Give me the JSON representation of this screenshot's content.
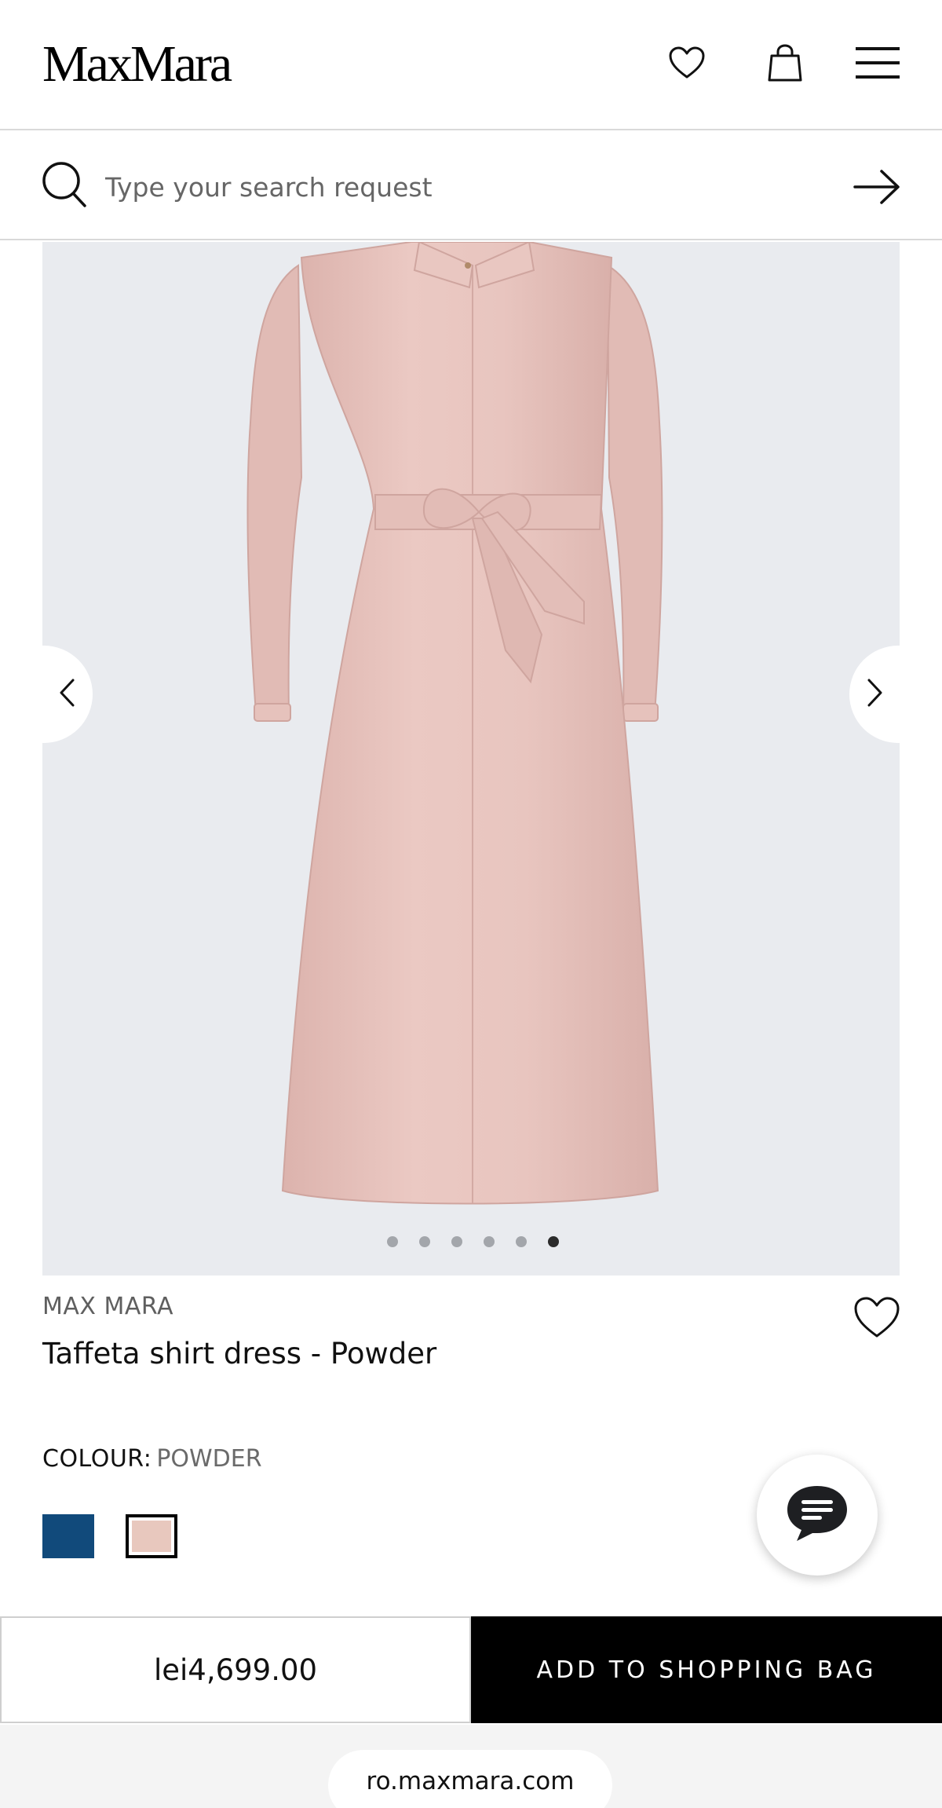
{
  "header": {
    "logo_text": "MaxMara",
    "icons": [
      "heart-icon",
      "shopping-bag-icon",
      "menu-icon"
    ]
  },
  "search": {
    "placeholder": "Type your search request",
    "value": "",
    "icons": [
      "search-icon",
      "arrow-right-icon"
    ]
  },
  "gallery": {
    "image_count": 6,
    "active_index": 5,
    "nav_icons": [
      "chevron-left-icon",
      "chevron-right-icon"
    ],
    "background_color": "#e9ebef",
    "garment_color": "#e6c2bc"
  },
  "product": {
    "brand": "MAX MARA",
    "name": "Taffeta shirt dress - Powder",
    "colour_label": "COLOUR:",
    "colour_value": "POWDER",
    "swatches": [
      {
        "name": "blue",
        "color": "#114a7b",
        "selected": false
      },
      {
        "name": "powder",
        "color": "#e8c8be",
        "selected": true
      }
    ]
  },
  "purchase": {
    "price": "lei4,699.00",
    "add_label": "ADD TO SHOPPING BAG"
  },
  "browser": {
    "url": "ro.maxmara.com"
  }
}
